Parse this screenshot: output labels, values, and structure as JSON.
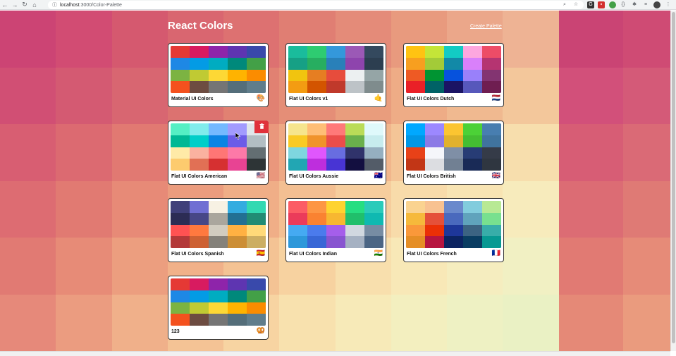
{
  "browser": {
    "host": "localhost",
    "path": ":3000/Color-Palette"
  },
  "header": {
    "title": "React Colors",
    "create_link": "Create Palette"
  },
  "background": {
    "rows": [
      [
        "#cc4474",
        "#d24c73",
        "#d5596f",
        "#d96670",
        "#dd7171",
        "#e07e73",
        "#e48b79",
        "#e89a7e",
        "#eba78a",
        "#eeb394",
        "#ca4474",
        "#cf4b74"
      ],
      [
        "#d14f74",
        "#d45a72",
        "#d86671",
        "#dc7270",
        "#e18172",
        "#e58e77",
        "#e99d7d",
        "#eeac86",
        "#f0b990",
        "#f3c79b",
        "#d2507a",
        "#d45a78"
      ],
      [
        "#d85e72",
        "#dc6a71",
        "#e17972",
        "#e58775",
        "#ea977c",
        "#eea884",
        "#f1b68c",
        "#f4c597",
        "#f6d2a2",
        "#f7dead",
        "#d75d75",
        "#da6a76"
      ],
      [
        "#dd6c72",
        "#e17a72",
        "#e78a77",
        "#eb9c7e",
        "#f0ae87",
        "#f3bf92",
        "#f6cd9d",
        "#f8dbaa",
        "#f8e4b3",
        "#f7ebbc",
        "#dc6c74",
        "#df7a75"
      ],
      [
        "#e17a73",
        "#e78b77",
        "#ec9e7f",
        "#f1b189",
        "#f4c394",
        "#f7d2a0",
        "#f8dfad",
        "#f8e8b7",
        "#f5edbf",
        "#f1f0c3",
        "#e17a73",
        "#e68b78"
      ],
      [
        "#e6897a",
        "#eb9c80",
        "#f0b08a",
        "#f4c395",
        "#f7d4a2",
        "#f8e1ae",
        "#f7eab8",
        "#f3efbf",
        "#eef1c3",
        "#eaf1c4",
        "#e58977",
        "#ea9b7e"
      ]
    ]
  },
  "cards": [
    {
      "name": "Material UI Colors",
      "emoji": "🎨",
      "colors": [
        "#e53935",
        "#d81b60",
        "#8e24aa",
        "#5e35b1",
        "#3949ab",
        "#1e88e5",
        "#039be5",
        "#00acc1",
        "#00897b",
        "#43a047",
        "#7cb342",
        "#c0ca33",
        "#fdd835",
        "#ffb300",
        "#fb8c00",
        "#f4511e",
        "#6d4c41",
        "#757575",
        "#546e7a",
        "#607d8b"
      ]
    },
    {
      "name": "Flat UI Colors v1",
      "emoji": "🤙",
      "colors": [
        "#1abc9c",
        "#2ecc71",
        "#3498db",
        "#9b59b6",
        "#34495e",
        "#16a085",
        "#27ae60",
        "#2980b9",
        "#8e44ad",
        "#2c3e50",
        "#f1c40f",
        "#e67e22",
        "#e74c3c",
        "#ecf0f1",
        "#95a5a6",
        "#f39c12",
        "#d35400",
        "#c0392b",
        "#bdc3c7",
        "#7f8c8d"
      ]
    },
    {
      "name": "Flat UI Colors Dutch",
      "emoji": "🇳🇱",
      "colors": [
        "#ffc312",
        "#c4e538",
        "#12cbc4",
        "#fda7df",
        "#ed4c67",
        "#f79f1f",
        "#a3cb38",
        "#1289a7",
        "#d980fa",
        "#b53471",
        "#ee5a24",
        "#009432",
        "#0652dd",
        "#9980fa",
        "#833471",
        "#ea2027",
        "#006266",
        "#1b1464",
        "#5758bb",
        "#6f1e51"
      ]
    },
    {
      "name": "Flat UI Colors American",
      "emoji": "🇺🇸",
      "colors": [
        "#55efc4",
        "#81ecec",
        "#74b9ff",
        "#a29bfe",
        "#dfe6e9",
        "#00b894",
        "#00cec9",
        "#0984e3",
        "#6c5ce7",
        "#b2bec3",
        "#ffeaa7",
        "#fab1a0",
        "#ff7675",
        "#fd79a8",
        "#636e72",
        "#fdcb6e",
        "#e17055",
        "#d63031",
        "#e84393",
        "#2d3436"
      ]
    },
    {
      "name": "Flat UI Colors Aussie",
      "emoji": "🇦🇺",
      "colors": [
        "#f6e58d",
        "#ffbe76",
        "#ff7979",
        "#badc58",
        "#dff9fb",
        "#f9ca24",
        "#f0932b",
        "#eb4d4b",
        "#6ab04c",
        "#c7ecee",
        "#7ed6df",
        "#e056fd",
        "#686de0",
        "#30336b",
        "#95afc0",
        "#22a6b3",
        "#be2edd",
        "#4834d4",
        "#130f40",
        "#535c68"
      ]
    },
    {
      "name": "Flat UI Colors British",
      "emoji": "🇬🇧",
      "colors": [
        "#00a8ff",
        "#9c88ff",
        "#fbc531",
        "#4cd137",
        "#487eb0",
        "#0097e6",
        "#8c7ae6",
        "#e1b12c",
        "#44bd32",
        "#40739e",
        "#e84118",
        "#f5f6fa",
        "#7f8fa6",
        "#273c75",
        "#353b48",
        "#c23616",
        "#dcdde1",
        "#718093",
        "#192a56",
        "#2f3640"
      ]
    },
    {
      "name": "Flat UI Colors Spanish",
      "emoji": "🇪🇸",
      "colors": [
        "#40407a",
        "#706fd3",
        "#f7f1e3",
        "#34ace0",
        "#33d9b2",
        "#2c2c54",
        "#474787",
        "#aaa69d",
        "#227093",
        "#218c74",
        "#ff5252",
        "#ff793f",
        "#d1ccc0",
        "#ffb142",
        "#ffda79",
        "#b33939",
        "#cd6133",
        "#84817a",
        "#cc8e35",
        "#ccae62"
      ]
    },
    {
      "name": "Flat UI Colors Indian",
      "emoji": "🇮🇳",
      "colors": [
        "#fc5c65",
        "#fd9644",
        "#fed330",
        "#26de81",
        "#2bcbba",
        "#eb3b5a",
        "#fa8231",
        "#f7b731",
        "#20bf6b",
        "#0fb9b1",
        "#45aaf2",
        "#4b7bec",
        "#a55eea",
        "#d1d8e0",
        "#778ca3",
        "#2d98da",
        "#3867d6",
        "#8854d0",
        "#a5b1c2",
        "#4b6584"
      ]
    },
    {
      "name": "Flat UI Colors French",
      "emoji": "🇫🇷",
      "colors": [
        "#fad390",
        "#f8c291",
        "#6a89cc",
        "#82ccdd",
        "#b8e994",
        "#f6b93b",
        "#e55039",
        "#4a69bd",
        "#60a3bc",
        "#78e08f",
        "#fa983a",
        "#eb2f06",
        "#1e3799",
        "#3c6382",
        "#38ada9",
        "#e58e26",
        "#b71540",
        "#0c2461",
        "#0a3d62",
        "#079992"
      ]
    },
    {
      "name": "123",
      "emoji": "🥨",
      "colors": [
        "#e53935",
        "#d81b60",
        "#8e24aa",
        "#5e35b1",
        "#3949ab",
        "#1e88e5",
        "#039be5",
        "#00acc1",
        "#00897b",
        "#43a047",
        "#7cb342",
        "#c0ca33",
        "#fdd835",
        "#ffb300",
        "#fb8c00",
        "#f4511e",
        "#6d4c41",
        "#757575",
        "#546e7a",
        "#607d8b"
      ]
    }
  ],
  "delete_icon": "trash-icon"
}
